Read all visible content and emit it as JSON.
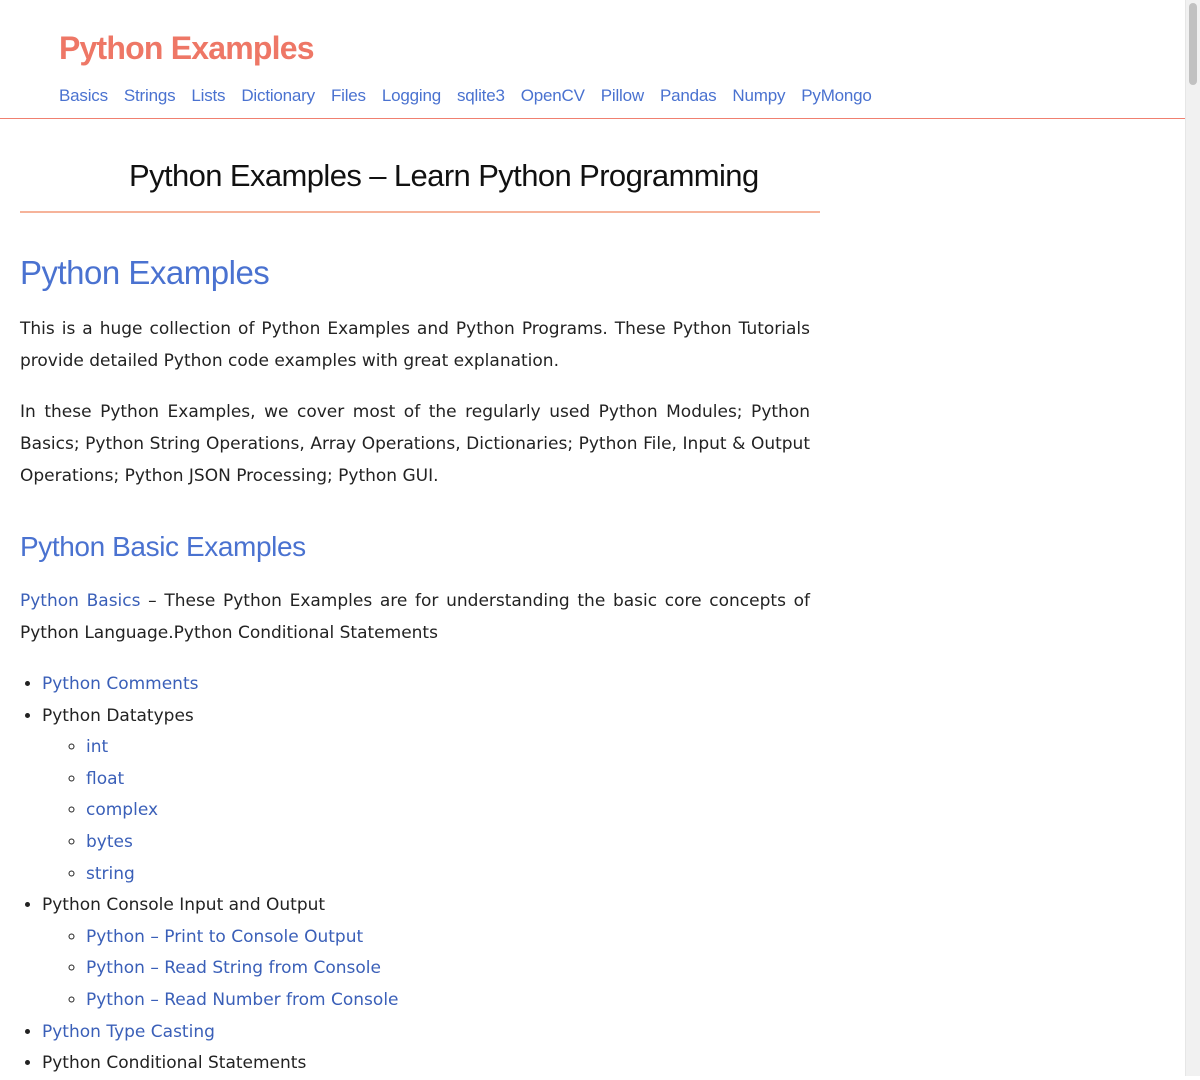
{
  "header": {
    "site_title": "Python Examples",
    "nav": [
      "Basics",
      "Strings",
      "Lists",
      "Dictionary",
      "Files",
      "Logging",
      "sqlite3",
      "OpenCV",
      "Pillow",
      "Pandas",
      "Numpy",
      "PyMongo"
    ]
  },
  "page": {
    "title": "Python Examples – Learn Python Programming",
    "section1": {
      "heading": "Python Examples",
      "para1": "This is a huge collection of Python Examples and Python Programs. These Python Tutorials provide detailed Python code examples with great explanation.",
      "para2": "In these Python Examples, we cover most of the regularly used Python Modules; Python Basics; Python String Operations, Array Operations, Dictionaries; Python File, Input & Output Operations; Python JSON Processing; Python GUI."
    },
    "section2": {
      "heading": "Python Basic Examples",
      "intro_link": "Python Basics",
      "intro_text": " – These Python Examples are for understanding the basic core concepts of Python Language.Python Conditional Statements"
    }
  },
  "topics": [
    {
      "label": "Python Comments",
      "link": true
    },
    {
      "label": "Python Datatypes",
      "link": false,
      "children": [
        "int",
        "float",
        "complex",
        "bytes",
        "string"
      ]
    },
    {
      "label": "Python Console Input and Output",
      "link": false,
      "children": [
        "Python – Print to Console Output",
        "Python – Read String from Console",
        "Python – Read Number from Console"
      ]
    },
    {
      "label": "Python Type Casting",
      "link": true
    },
    {
      "label": "Python Conditional Statements",
      "link": false
    }
  ],
  "colors": {
    "brand": "#ee7766",
    "link": "#4a72d0",
    "body_link": "#3a5fb8",
    "text": "#222222",
    "divider": "#f6b39a"
  }
}
